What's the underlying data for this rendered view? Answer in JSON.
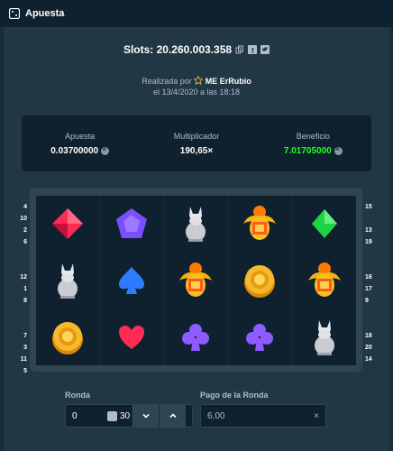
{
  "window": {
    "title": "Apuesta",
    "icon": "game-modal-icon"
  },
  "header": {
    "slots_text": "Slots: 20.260.003.358",
    "icons": [
      "copy-icon",
      "facebook-icon",
      "twitter-icon"
    ],
    "made_by_prefix": "Realizada por",
    "star_icon": "star-icon",
    "user": "ME ErRubio",
    "date_text": "el 13/4/2020 a las 18:18"
  },
  "stats": {
    "bet": {
      "label": "Apuesta",
      "value": "0.03700000",
      "currency_icon": "coin-icon"
    },
    "multiplier": {
      "label": "Multiplicador",
      "value": "190,65×"
    },
    "profit": {
      "label": "Beneficio",
      "value": "7.01705000",
      "currency_icon": "coin-icon",
      "color": "#1fff20"
    }
  },
  "board": {
    "left_lines": [
      "4",
      "10",
      "2",
      "6",
      "",
      "",
      "12",
      "1",
      "8",
      "",
      "",
      "7",
      "3",
      "11",
      "5"
    ],
    "right_lines": [
      "15",
      "",
      "13",
      "19",
      "",
      "",
      "16",
      "17",
      "9",
      "",
      "",
      "18",
      "20",
      "14"
    ],
    "cells": [
      "red-diamond-icon",
      "purple-pentagon-icon",
      "cat-statue-icon",
      "golden-scarab-icon",
      "green-diamond-icon",
      "cat-statue-icon",
      "blue-spade-icon",
      "golden-scarab-icon",
      "gold-coin-icon",
      "golden-scarab-icon",
      "gold-coin-icon",
      "red-heart-icon",
      "purple-club-icon",
      "purple-club-icon",
      "cat-statue-icon"
    ]
  },
  "controls": {
    "round_label": "Ronda",
    "round_value": "0",
    "round_total": "30",
    "payout_label": "Pago de la Ronda",
    "payout_value": "6,00"
  },
  "colors": {
    "bg": "#1a2c38",
    "panel": "#213743",
    "dark": "#0f212e",
    "accent": "#2f4553",
    "green": "#1fff20"
  }
}
